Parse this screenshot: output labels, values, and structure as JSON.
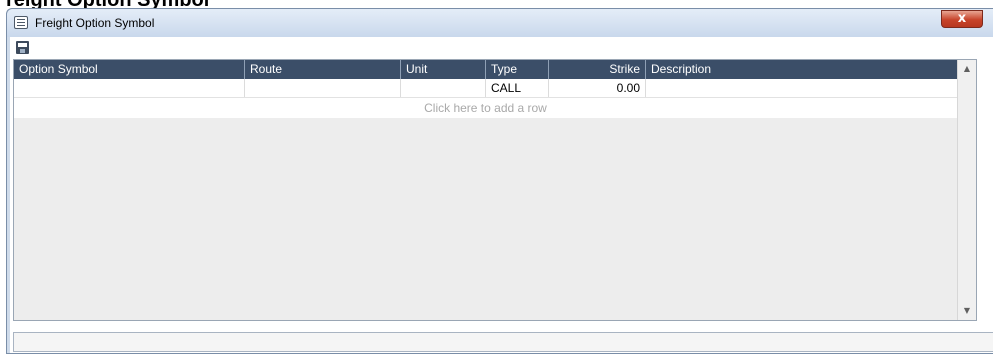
{
  "document": {
    "heading": "reight Option Symbol"
  },
  "window": {
    "title": "Freight Option Symbol",
    "close_label": "x"
  },
  "toolbar": {
    "save_icon": "save-icon"
  },
  "grid": {
    "columns": [
      "Option Symbol",
      "Route",
      "Unit",
      "Type",
      "Strike",
      "Description"
    ],
    "rows": [
      {
        "option_symbol": "",
        "route": "",
        "unit": "",
        "type": "CALL",
        "strike": "0.00",
        "description": ""
      }
    ],
    "add_row_text": "Click here to add a row"
  },
  "scrollbar": {
    "up_arrow": "▲",
    "down_arrow": "▼"
  }
}
